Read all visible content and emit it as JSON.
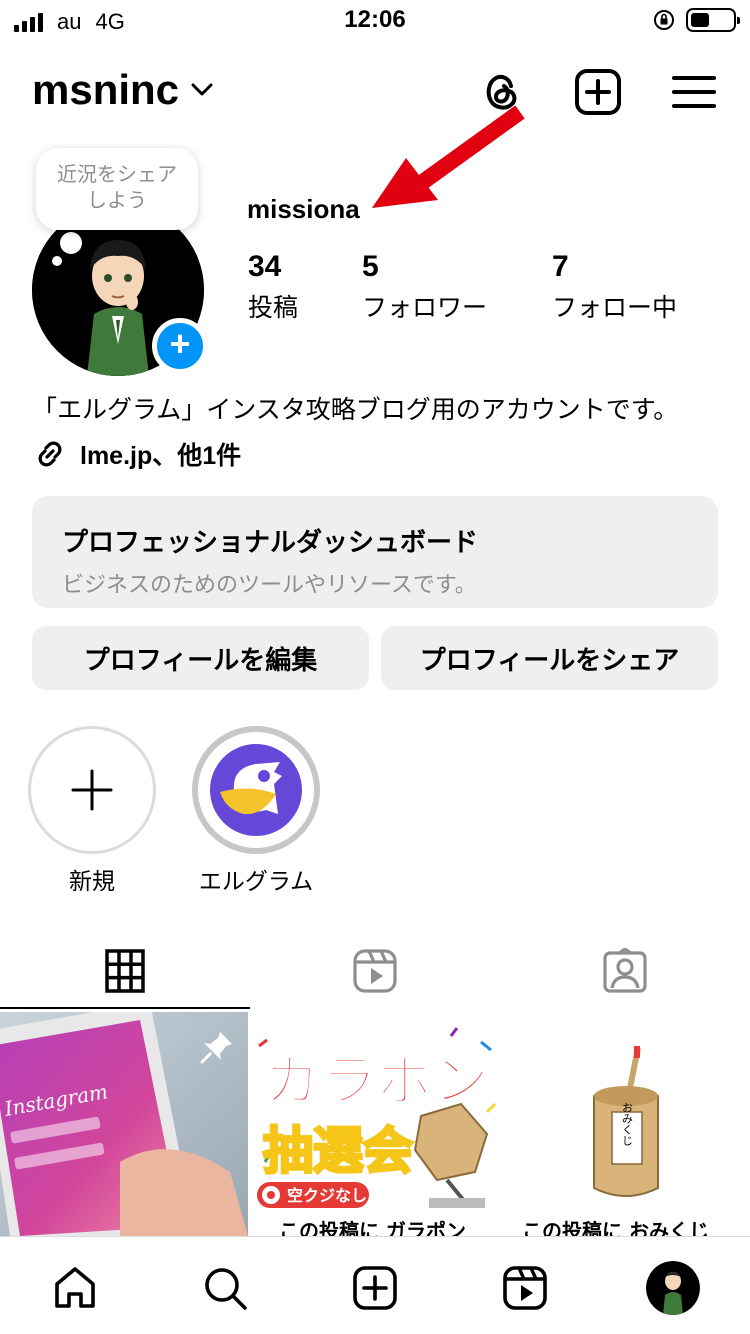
{
  "status_bar": {
    "carrier": "au",
    "network": "4G",
    "time": "12:06"
  },
  "header": {
    "account_name": "msninc"
  },
  "profile": {
    "note_text_line1": "近況をシェア",
    "note_text_line2": "しよう",
    "username": "missiona",
    "stats": [
      {
        "count": "34",
        "label": "投稿"
      },
      {
        "count": "5",
        "label": "フォロワー"
      },
      {
        "count": "7",
        "label": "フォロー中"
      }
    ],
    "bio": "「エルグラム」インスタ攻略ブログ用のアカウントです。",
    "link_text": "lme.jp、他1件"
  },
  "dashboard": {
    "title": "プロフェッショナルダッシュボード",
    "subtitle": "ビジネスのためのツールやリソースです。"
  },
  "buttons": {
    "edit_profile": "プロフィールを編集",
    "share_profile": "プロフィールをシェア"
  },
  "highlights": [
    {
      "label": "新規"
    },
    {
      "label": "エルグラム"
    }
  ],
  "posts": [
    {
      "text": "Instagram",
      "pinned": true
    },
    {
      "line1": "ガラポン",
      "line2": "抽選会",
      "badge": "空クジなし!",
      "caption": "この投稿に ガラポン"
    },
    {
      "tag": "おみくじ",
      "caption": "この投稿に おみくじ"
    }
  ],
  "colors": {
    "accent": "#0095f6",
    "annotation_arrow": "#e0000f",
    "button_bg": "#efefef"
  }
}
